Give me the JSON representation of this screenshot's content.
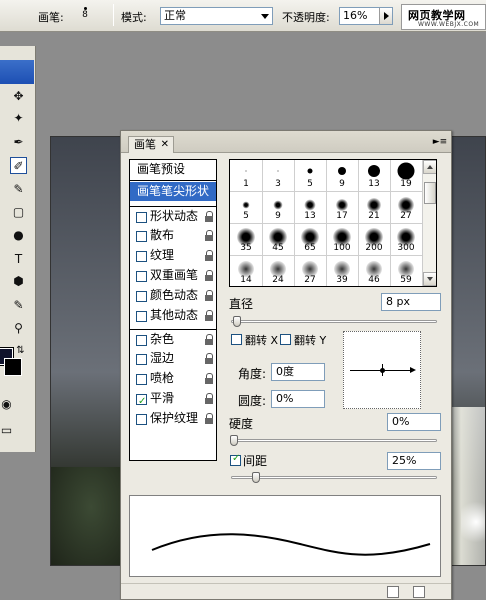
{
  "options_bar": {
    "brush_label": "画笔:",
    "brush_size": "8",
    "mode_label": "模式:",
    "mode_value": "正常",
    "opacity_label": "不透明度:",
    "opacity_value": "16%",
    "watermark_title": "网页教学网",
    "watermark_url": "WWW.WEBJX.COM"
  },
  "panel": {
    "tab_title": "画笔",
    "list": [
      {
        "label": "画笔预设",
        "kind": "header"
      },
      {
        "label": "画笔笔尖形状",
        "kind": "active"
      },
      {
        "label": "形状动态",
        "checked": false,
        "locked": true
      },
      {
        "label": "散布",
        "checked": false,
        "locked": true
      },
      {
        "label": "纹理",
        "checked": false,
        "locked": true
      },
      {
        "label": "双重画笔",
        "checked": false,
        "locked": true
      },
      {
        "label": "颜色动态",
        "checked": false,
        "locked": true
      },
      {
        "label": "其他动态",
        "checked": false,
        "locked": true
      },
      {
        "label": "杂色",
        "checked": false,
        "locked": true
      },
      {
        "label": "湿边",
        "checked": false,
        "locked": true
      },
      {
        "label": "喷枪",
        "checked": false,
        "locked": true
      },
      {
        "label": "平滑",
        "checked": true,
        "locked": true
      },
      {
        "label": "保护纹理",
        "checked": false,
        "locked": true
      }
    ],
    "brush_sizes": [
      "1",
      "3",
      "5",
      "9",
      "13",
      "19",
      "5",
      "9",
      "13",
      "17",
      "21",
      "27",
      "35",
      "45",
      "65",
      "100",
      "200",
      "300",
      "14",
      "24",
      "27",
      "39",
      "46",
      "59"
    ],
    "selected_brush_index": 0,
    "diameter_label": "直径",
    "diameter_value": "8 px",
    "flip_x_label": "翻转 X",
    "flip_y_label": "翻转 Y",
    "angle_label": "角度:",
    "angle_value": "0度",
    "roundness_label": "圆度:",
    "roundness_value": "0%",
    "hardness_label": "硬度",
    "hardness_value": "0%",
    "spacing_label": "间距",
    "spacing_checked": true,
    "spacing_value": "25%"
  }
}
